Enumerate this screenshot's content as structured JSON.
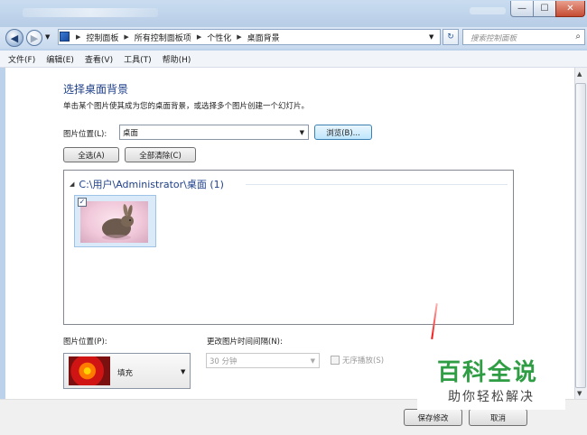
{
  "window": {
    "minimize": "—",
    "maximize": "☐",
    "close": "✕"
  },
  "address": {
    "crumbs": [
      "控制面板",
      "所有控制面板项",
      "个性化",
      "桌面背景"
    ],
    "search_placeholder": "搜索控制面板"
  },
  "menu": [
    "文件(F)",
    "编辑(E)",
    "查看(V)",
    "工具(T)",
    "帮助(H)"
  ],
  "main": {
    "title": "选择桌面背景",
    "description": "单击某个图片使其成为您的桌面背景，或选择多个图片创建一个幻灯片。",
    "location_label": "图片位置(L):",
    "location_value": "桌面",
    "browse_button": "浏览(B)...",
    "select_all_button": "全选(A)",
    "clear_all_button": "全部清除(C)",
    "group_header": "C:\\用户\\Administrator\\桌面 (1)",
    "items": [
      {
        "checked": true,
        "icon": "rabbit-photo"
      }
    ]
  },
  "options": {
    "position_label": "图片位置(P):",
    "position_value": "填充",
    "interval_label": "更改图片时间间隔(N):",
    "interval_value": "30 分钟",
    "shuffle_label": "无序播放(S)",
    "shuffle_checked": false
  },
  "footer": {
    "save_button": "保存修改",
    "cancel_button": "取消"
  },
  "watermark": {
    "line1": "百科全说",
    "line2": "助你轻松解决"
  }
}
